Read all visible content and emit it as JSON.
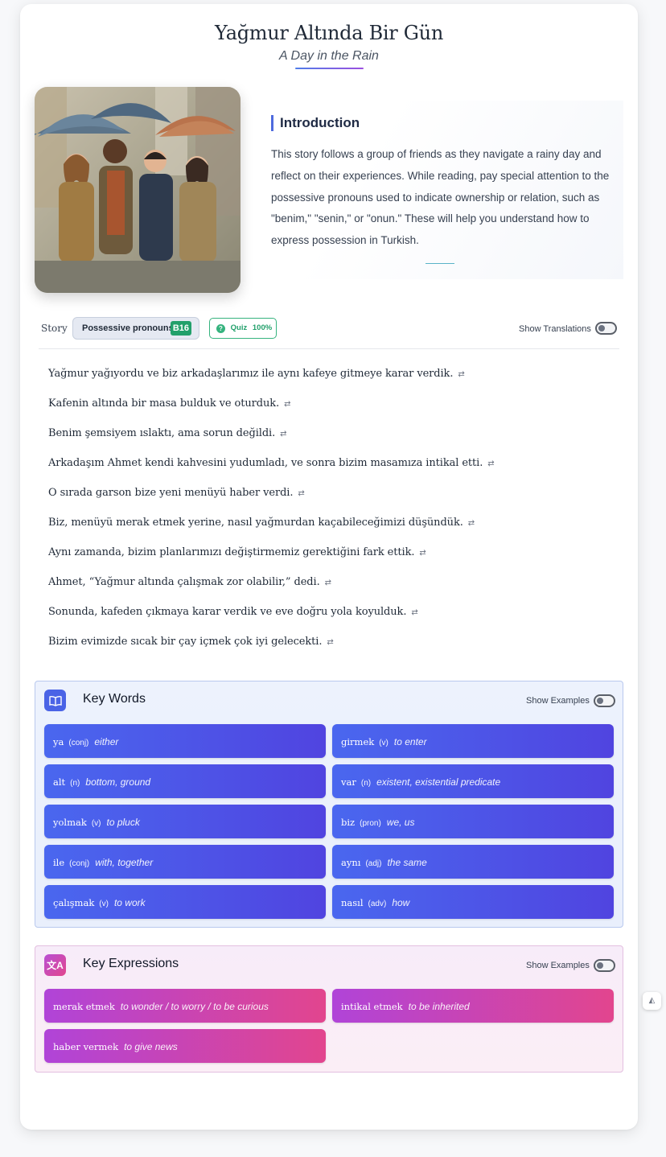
{
  "story": {
    "title": "Yağmur Altında Bir Gün",
    "subtitle": "A Day in the Rain"
  },
  "intro": {
    "heading": "Introduction",
    "text": "This story follows a group of friends as they navigate a rainy day and reflect on their experiences. While reading, pay special attention to the possessive pronouns used to indicate ownership or relation, such as \"benim,\" \"senin,\" or \"onun.\" These will help you understand how to express possession in Turkish."
  },
  "toolbar": {
    "story_label": "Story",
    "topic_label": "Possessive pronouns",
    "level": "B16",
    "quiz_label": "Quiz",
    "quiz_score": "100%",
    "show_translations": "Show Translations"
  },
  "sentences": [
    "Yağmur yağıyordu ve biz arkadaşlarımız ile aynı kafeye gitmeye karar verdik.",
    "Kafenin altında bir masa bulduk ve oturduk.",
    "Benim şemsiyem ıslaktı, ama sorun değildi.",
    "Arkadaşım Ahmet kendi kahvesini yudumladı, ve sonra bizim masamıza intikal etti.",
    "O sırada garson bize yeni menüyü haber verdi.",
    "Biz, menüyü merak etmek yerine, nasıl yağmurdan kaçabileceğimizi düşündük.",
    "Aynı zamanda, bizim planlarımızı değiştirmemiz gerektiğini fark ettik.",
    "Ahmet, “Yağmur altında çalışmak zor olabilir,” dedi.",
    "Sonunda, kafeden çıkmaya karar verdik ve eve doğru yola koyulduk.",
    "Bizim evimizde sıcak bir çay içmek çok iyi gelecekti."
  ],
  "key_words": {
    "title": "Key Words",
    "show_examples": "Show Examples",
    "items": [
      {
        "word": "ya",
        "pos": "(conj)",
        "gloss": "either"
      },
      {
        "word": "girmek",
        "pos": "(v)",
        "gloss": "to enter"
      },
      {
        "word": "alt",
        "pos": "(n)",
        "gloss": "bottom, ground"
      },
      {
        "word": "var",
        "pos": "(n)",
        "gloss": "existent, existential predicate"
      },
      {
        "word": "yolmak",
        "pos": "(v)",
        "gloss": "to pluck"
      },
      {
        "word": "biz",
        "pos": "(pron)",
        "gloss": "we, us"
      },
      {
        "word": "ile",
        "pos": "(conj)",
        "gloss": "with, together"
      },
      {
        "word": "aynı",
        "pos": "(adj)",
        "gloss": "the same"
      },
      {
        "word": "çalışmak",
        "pos": "(v)",
        "gloss": "to work"
      },
      {
        "word": "nasıl",
        "pos": "(adv)",
        "gloss": "how"
      }
    ]
  },
  "key_expressions": {
    "title": "Key Expressions",
    "show_examples": "Show Examples",
    "items": [
      {
        "phrase": "merak etmek",
        "gloss": "to wonder / to worry / to be curious"
      },
      {
        "phrase": "intikal etmek",
        "gloss": "to be inherited"
      },
      {
        "phrase": "haber vermek",
        "gloss": "to give news"
      }
    ]
  },
  "colors": {
    "accent_blue": "#4a63e6",
    "accent_magenta": "#e2458e",
    "badge_green": "#22a06b"
  }
}
